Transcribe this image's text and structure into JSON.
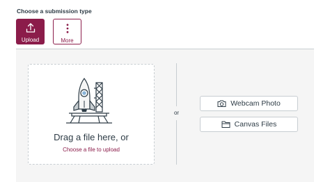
{
  "heading": "Choose a submission type",
  "submission_types": [
    {
      "label": "Upload",
      "icon": "upload-icon",
      "selected": true
    },
    {
      "label": "More",
      "icon": "more-vertical-icon",
      "selected": false
    }
  ],
  "dropzone": {
    "title": "Drag a file here, or",
    "link": "Choose a file to upload",
    "illustration": "rocket-launch-illustration"
  },
  "divider_text": "or",
  "side_buttons": [
    {
      "label": "Webcam Photo",
      "icon": "camera-icon"
    },
    {
      "label": "Canvas Files",
      "icon": "folder-icon"
    }
  ],
  "colors": {
    "accent": "#8b1c4a",
    "text": "#2d3b45",
    "border": "#c7cdd1",
    "panel_background": "#f5f5f5"
  }
}
